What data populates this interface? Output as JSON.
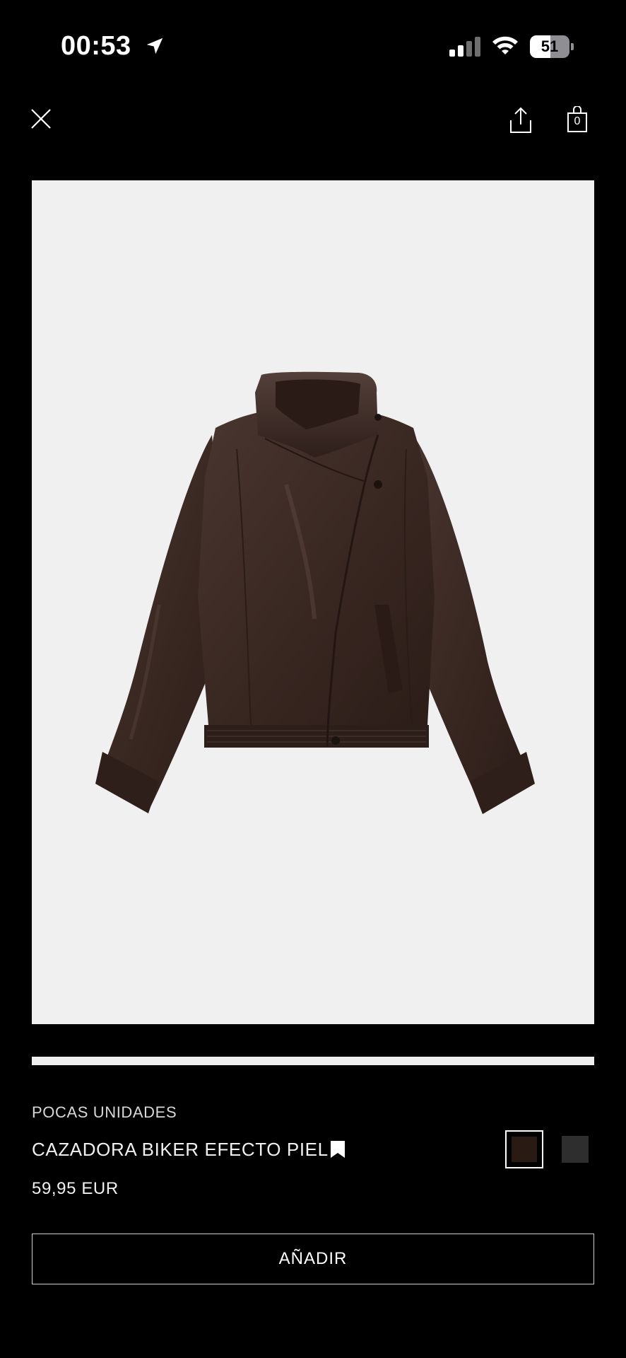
{
  "status_bar": {
    "time": "00:53",
    "battery_level": "51",
    "battery_fraction": 0.51,
    "icons": [
      "location-arrow-icon",
      "cellular-signal-icon",
      "wifi-icon",
      "battery-icon"
    ]
  },
  "top_bar": {
    "icons": [
      "close-icon",
      "share-icon",
      "shopping-bag-icon"
    ],
    "bag_count": "0"
  },
  "product": {
    "stock_note": "POCAS UNIDADES",
    "name": "CAZADORA BIKER EFECTO PIEL",
    "price": "59,95 EUR",
    "image_progress_fraction": 1.0,
    "colors": {
      "selected": "#2a1a14",
      "other": "#2e2e2e"
    }
  },
  "actions": {
    "add_label": "AÑADIR"
  },
  "theme": {
    "background": "#000000",
    "text": "#ffffff",
    "image_background": "#f0f0f0",
    "jacket_color": "#3a2822"
  }
}
